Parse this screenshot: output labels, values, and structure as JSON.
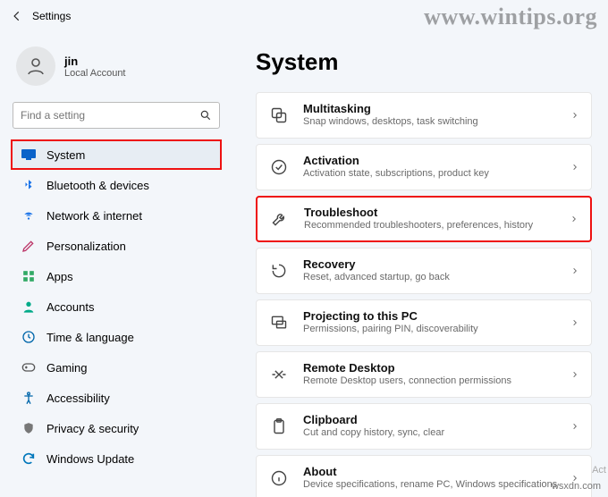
{
  "watermark_top": "www.wintips.org",
  "watermark_bottom": "wsxdn.com",
  "activation_hint": "Act",
  "header": {
    "back_icon": "←",
    "title": "Settings"
  },
  "user": {
    "name": "jin",
    "account": "Local Account"
  },
  "search": {
    "placeholder": "Find a setting"
  },
  "sidebar": {
    "items": [
      {
        "key": "system",
        "label": "System",
        "active": true
      },
      {
        "key": "bluetooth",
        "label": "Bluetooth & devices"
      },
      {
        "key": "network",
        "label": "Network & internet"
      },
      {
        "key": "personalization",
        "label": "Personalization"
      },
      {
        "key": "apps",
        "label": "Apps"
      },
      {
        "key": "accounts",
        "label": "Accounts"
      },
      {
        "key": "time",
        "label": "Time & language"
      },
      {
        "key": "gaming",
        "label": "Gaming"
      },
      {
        "key": "accessibility",
        "label": "Accessibility"
      },
      {
        "key": "privacy",
        "label": "Privacy & security"
      },
      {
        "key": "update",
        "label": "Windows Update"
      }
    ]
  },
  "main": {
    "title": "System",
    "cards": [
      {
        "key": "multitasking",
        "title": "Multitasking",
        "sub": "Snap windows, desktops, task switching"
      },
      {
        "key": "activation",
        "title": "Activation",
        "sub": "Activation state, subscriptions, product key"
      },
      {
        "key": "troubleshoot",
        "title": "Troubleshoot",
        "sub": "Recommended troubleshooters, preferences, history",
        "highlight": true
      },
      {
        "key": "recovery",
        "title": "Recovery",
        "sub": "Reset, advanced startup, go back"
      },
      {
        "key": "projecting",
        "title": "Projecting to this PC",
        "sub": "Permissions, pairing PIN, discoverability"
      },
      {
        "key": "remote",
        "title": "Remote Desktop",
        "sub": "Remote Desktop users, connection permissions"
      },
      {
        "key": "clipboard",
        "title": "Clipboard",
        "sub": "Cut and copy history, sync, clear"
      },
      {
        "key": "about",
        "title": "About",
        "sub": "Device specifications, rename PC, Windows specifications"
      }
    ]
  }
}
